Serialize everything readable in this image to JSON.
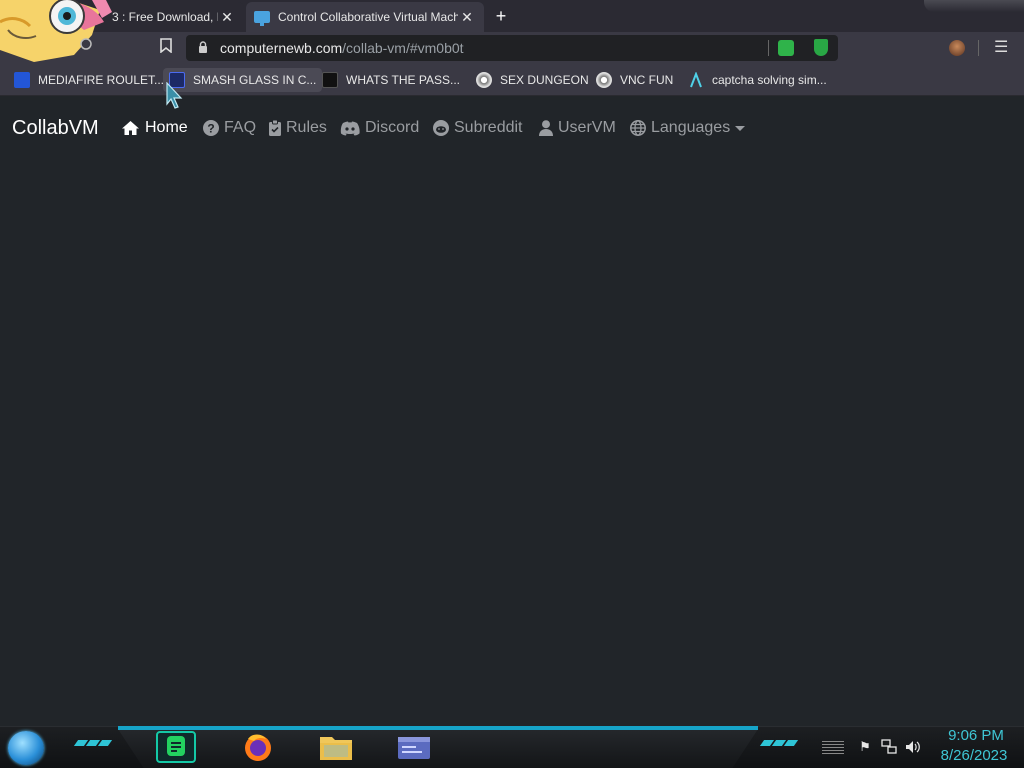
{
  "browser": {
    "tabs": [
      {
        "title": "3 : Free Download, E",
        "active": false
      },
      {
        "title": "Control Collaborative Virtual Mach",
        "active": true
      }
    ],
    "new_tab_label": "+",
    "url": {
      "domain": "computernewb.com",
      "path": "/collab-vm/#vm0b0t"
    },
    "bookmarks": [
      {
        "label": "MEDIAFIRE ROULET...",
        "icon": "mediafire-icon"
      },
      {
        "label": "SMASH GLASS IN C...",
        "icon": "shield-icon"
      },
      {
        "label": "WHATS THE PASS...",
        "icon": "dark-square-icon"
      },
      {
        "label": "SEX DUNGEON",
        "icon": "wheel-icon"
      },
      {
        "label": "VNC FUN",
        "icon": "wheel-icon"
      },
      {
        "label": "captcha solving sim...",
        "icon": "lambda-icon"
      }
    ]
  },
  "page": {
    "brand": "CollabVM",
    "nav": [
      {
        "label": "Home",
        "icon": "home-icon",
        "active": true
      },
      {
        "label": "FAQ",
        "icon": "question-icon",
        "active": false
      },
      {
        "label": "Rules",
        "icon": "clipboard-check-icon",
        "active": false
      },
      {
        "label": "Discord",
        "icon": "discord-icon",
        "active": false
      },
      {
        "label": "Subreddit",
        "icon": "reddit-icon",
        "active": false
      },
      {
        "label": "UserVM",
        "icon": "user-icon",
        "active": false
      },
      {
        "label": "Languages",
        "icon": "globe-icon",
        "active": false,
        "dropdown": true
      }
    ]
  },
  "taskbar": {
    "time": "9:06 PM",
    "date": "8/26/2023",
    "apps": [
      "chat-app-icon",
      "firefox-icon",
      "file-explorer-icon",
      "window-app-icon"
    ]
  },
  "colors": {
    "page_bg": "#212529",
    "nav_text": "#9a9da1",
    "clock": "#3fc6d4",
    "accent": "#16a4c8"
  }
}
